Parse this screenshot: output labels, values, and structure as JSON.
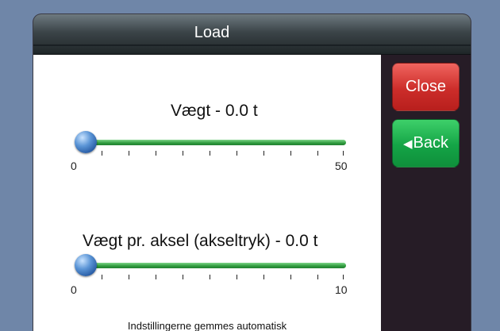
{
  "header": {
    "title": "Load"
  },
  "buttons": {
    "close_label": "Close",
    "back_label": "Back"
  },
  "sliders": [
    {
      "label": "Vægt - 0.0 t",
      "min_label": "0",
      "max_label": "50",
      "value": 0.0
    },
    {
      "label": "Vægt pr. aksel (akseltryk) - 0.0 t",
      "min_label": "0",
      "max_label": "10",
      "value": 0.0
    }
  ],
  "footer": {
    "note": "Indstillingerne gemmes automatisk"
  }
}
